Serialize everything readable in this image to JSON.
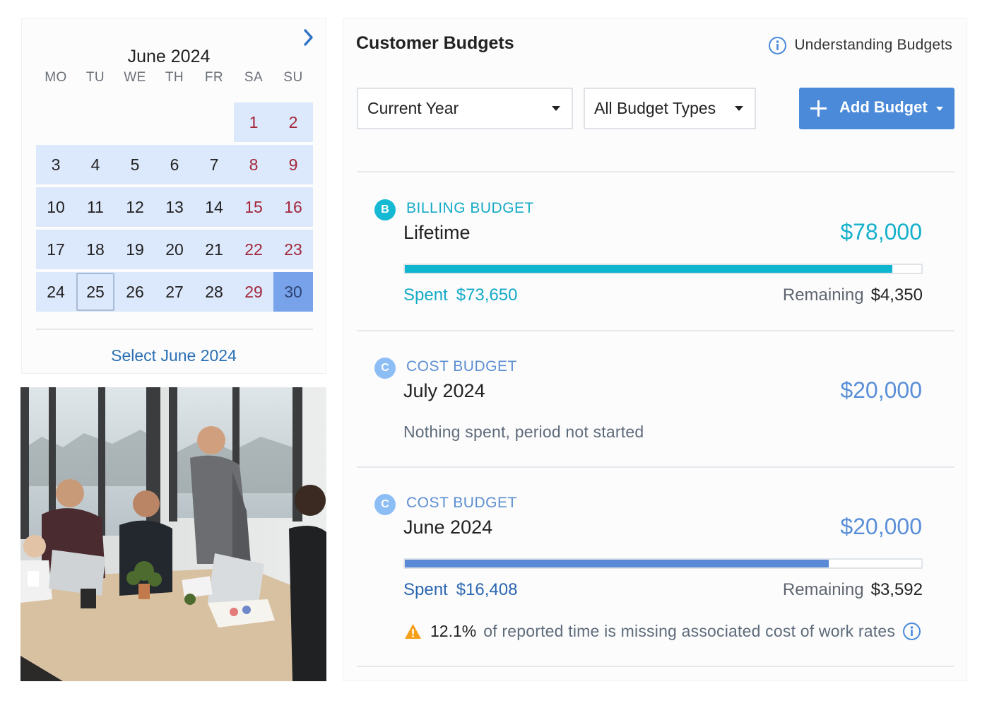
{
  "calendar": {
    "month_title": "June 2024",
    "weekdays": [
      "MO",
      "TU",
      "WE",
      "TH",
      "FR",
      "SA",
      "SU"
    ],
    "weeks": [
      [
        "",
        "",
        "",
        "",
        "",
        "1",
        "2"
      ],
      [
        "3",
        "4",
        "5",
        "6",
        "7",
        "8",
        "9"
      ],
      [
        "10",
        "11",
        "12",
        "13",
        "14",
        "15",
        "16"
      ],
      [
        "17",
        "18",
        "19",
        "20",
        "21",
        "22",
        "23"
      ],
      [
        "24",
        "25",
        "26",
        "27",
        "28",
        "29",
        "30"
      ]
    ],
    "today": "25",
    "selected": "30",
    "select_label": "Select June 2024",
    "next_icon": "chevron-right-icon"
  },
  "photo": {
    "subject": "team meeting around a conference table"
  },
  "budgets_panel": {
    "title": "Customer Budgets",
    "help_label": "Understanding Budgets",
    "period_filter": "Current Year",
    "type_filter": "All Budget Types",
    "add_label": "Add Budget"
  },
  "budgets": [
    {
      "badge": "B",
      "type": "BILLING BUDGET",
      "name": "Lifetime",
      "amount": "$78,000",
      "spent_label": "Spent",
      "spent": "$73,650",
      "remaining_label": "Remaining",
      "remaining": "$4,350",
      "progress": 0.944,
      "color": "#0fb4cf"
    },
    {
      "badge": "C",
      "type": "COST BUDGET",
      "name": "July 2024",
      "amount": "$20,000",
      "note": "Nothing spent, period not started",
      "color": "#78aef0"
    },
    {
      "badge": "C",
      "type": "COST BUDGET",
      "name": "June 2024",
      "amount": "$20,000",
      "spent_label": "Spent",
      "spent": "$16,408",
      "remaining_label": "Remaining",
      "remaining": "$3,592",
      "progress": 0.8204,
      "warning_pct": "12.1%",
      "warning_text": "of reported time is missing associated cost of work rates",
      "color": "#5a8ad6"
    }
  ],
  "colors": {
    "accent_blue": "#4a8ad9",
    "weekend_red": "#a3263a",
    "calendar_fill": "#dce8fb",
    "selected_fill": "#78a3eb",
    "billing_teal": "#0fb4cf",
    "cost_text_blue": "#5a8ad6",
    "warning_orange": "#f5a01a"
  }
}
